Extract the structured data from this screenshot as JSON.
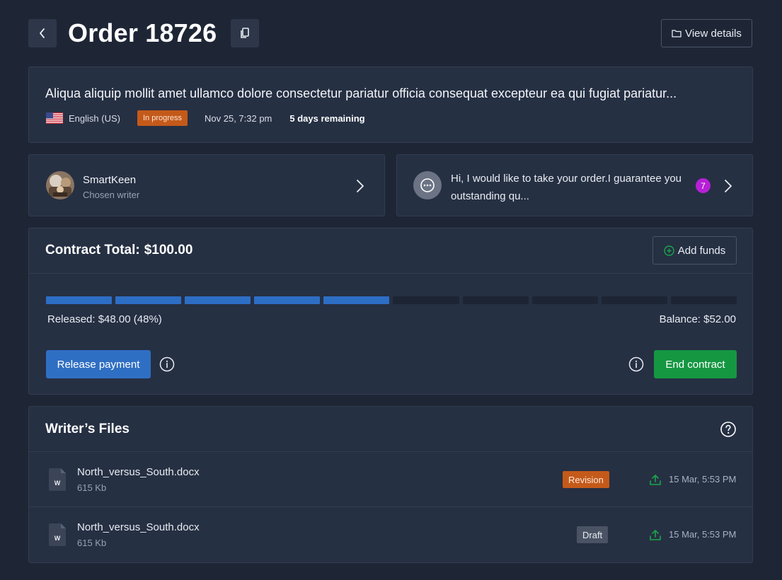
{
  "header": {
    "title": "Order 18726",
    "view_details_label": "View details"
  },
  "summary": {
    "text": "Aliqua aliquip mollit amet ullamco dolore consectetur pariatur officia consequat excepteur ea qui fugiat pariatur...",
    "language": "English (US)",
    "status": "In progress",
    "date": "Nov 25, 7:32 pm",
    "remaining": "5 days remaining"
  },
  "writer": {
    "name": "SmartKeen",
    "role": "Chosen writer"
  },
  "message": {
    "text": "Hi, I would like to take your order.I guarantee you outstanding qu...",
    "count": "7"
  },
  "contract": {
    "title_label": "Contract Total:",
    "total": "$100.00",
    "add_funds_label": "Add funds",
    "progress_fraction": 0.48,
    "segments_total": 10,
    "released": "Released: $48.00 (48%)",
    "balance": "Balance: $52.00",
    "release_label": "Release payment",
    "end_label": "End contract"
  },
  "files": {
    "title": "Writer’s Files",
    "items": [
      {
        "name": "North_versus_South.docx",
        "size": "615 Kb",
        "tag": "Revision",
        "time": "15 Mar, 5:53 PM",
        "doc_letter": "W"
      },
      {
        "name": "North_versus_South.docx",
        "size": "615 Kb",
        "tag": "Draft",
        "time": "15 Mar, 5:53 PM",
        "doc_letter": "W"
      }
    ]
  },
  "colors": {
    "background": "#1e2636",
    "card": "#263043",
    "primary": "#2f6fc3",
    "success": "#159742",
    "warning": "#c45a1a",
    "badge": "#b620d6"
  },
  "icons": {
    "back": "chevron-left-icon",
    "copy": "copy-icon",
    "folder": "folder-icon",
    "flag": "us-flag-icon",
    "chat": "chat-bubble-icon",
    "add": "plus-circle-icon",
    "info": "info-icon",
    "help": "question-circle-icon",
    "doc": "word-document-icon",
    "upload": "upload-icon"
  }
}
